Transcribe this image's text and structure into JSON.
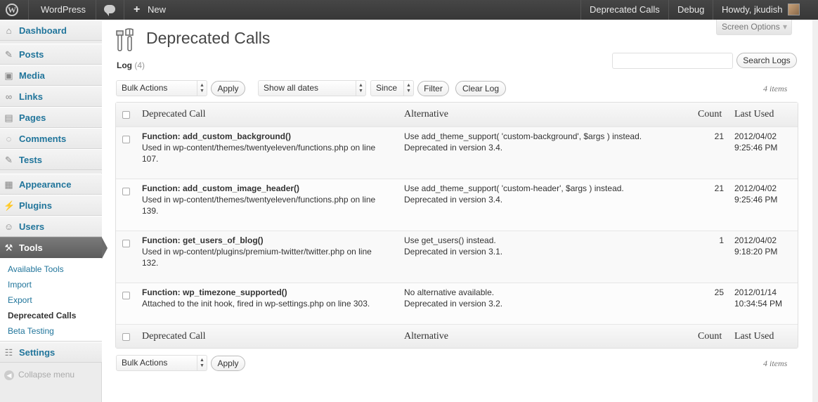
{
  "adminbar": {
    "site_name": "WordPress",
    "new_label": "New",
    "new_plus": "+",
    "right_items": [
      "Deprecated Calls",
      "Debug"
    ],
    "howdy": "Howdy, jkudish"
  },
  "sidebar": {
    "items": [
      {
        "label": "Dashboard",
        "icon": "dashboard-icon"
      },
      {
        "label": "Posts",
        "icon": "pin-icon"
      },
      {
        "label": "Media",
        "icon": "media-icon"
      },
      {
        "label": "Links",
        "icon": "link-icon"
      },
      {
        "label": "Pages",
        "icon": "page-icon"
      },
      {
        "label": "Comments",
        "icon": "comment-icon"
      },
      {
        "label": "Tests",
        "icon": "pin-icon"
      },
      {
        "label": "Appearance",
        "icon": "appearance-icon"
      },
      {
        "label": "Plugins",
        "icon": "plug-icon"
      },
      {
        "label": "Users",
        "icon": "users-icon"
      },
      {
        "label": "Tools",
        "icon": "tools-icon"
      },
      {
        "label": "Settings",
        "icon": "settings-icon"
      }
    ],
    "tools_submenu": [
      "Available Tools",
      "Import",
      "Export",
      "Deprecated Calls",
      "Beta Testing"
    ],
    "collapse_label": "Collapse menu"
  },
  "screen_options": "Screen Options",
  "page": {
    "title": "Deprecated Calls",
    "subtitle": "Log",
    "subtitle_count": "(4)",
    "search_button": "Search Logs",
    "bulk_actions": "Bulk Actions",
    "apply": "Apply",
    "dates_filter": "Show all dates",
    "since": "Since",
    "filter": "Filter",
    "clear_log": "Clear Log",
    "items_count": "4 items"
  },
  "table": {
    "columns": [
      "Deprecated Call",
      "Alternative",
      "Count",
      "Last Used"
    ],
    "rows": [
      {
        "fn": "Function: add_custom_background()",
        "used1": "Used in wp-content/themes/twentyeleven/functions.php on line",
        "used2": "107.",
        "alt1": "Use add_theme_support( 'custom-background', $args ) instead.",
        "alt2": "Deprecated in version 3.4.",
        "count": "21",
        "date": "2012/04/02",
        "time": "9:25:46 PM"
      },
      {
        "fn": "Function: add_custom_image_header()",
        "used1": "Used in wp-content/themes/twentyeleven/functions.php on line",
        "used2": "139.",
        "alt1": "Use add_theme_support( 'custom-header', $args ) instead.",
        "alt2": "Deprecated in version 3.4.",
        "count": "21",
        "date": "2012/04/02",
        "time": "9:25:46 PM"
      },
      {
        "fn": "Function: get_users_of_blog()",
        "used1": "Used in wp-content/plugins/premium-twitter/twitter.php on line",
        "used2": "132.",
        "alt1": "Use get_users() instead.",
        "alt2": "Deprecated in version 3.1.",
        "count": "1",
        "date": "2012/04/02",
        "time": "9:18:20 PM"
      },
      {
        "fn": "Function: wp_timezone_supported()",
        "used1": "Attached to the init hook, fired in wp-settings.php on line 303.",
        "used2": "",
        "alt1": "No alternative available.",
        "alt2": "Deprecated in version 3.2.",
        "count": "25",
        "date": "2012/01/14",
        "time": "10:34:54 PM"
      }
    ]
  }
}
